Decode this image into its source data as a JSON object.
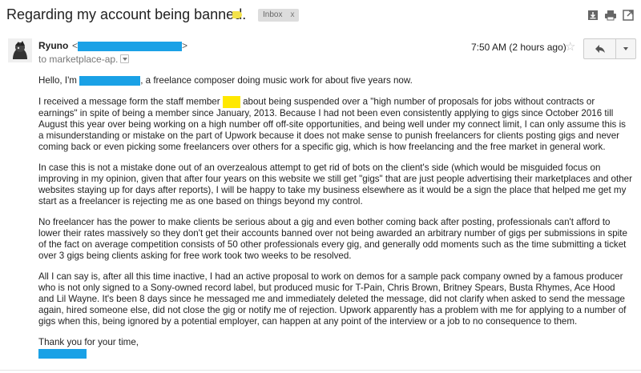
{
  "subject": "Regarding my account being banned.",
  "label": {
    "name": "Inbox",
    "remove": "x"
  },
  "sender": {
    "name": "Ryuno",
    "email_open": "<",
    "email_close": ">"
  },
  "recipient": "to marketplace-ap.",
  "time": "7:50 AM (2 hours ago)",
  "body": {
    "greeting_before": "Hello, I'm",
    "greeting_after": ", a freelance composer doing music work for about five years now.",
    "p1_before": "I received a message form the staff member",
    "p1_after": "about being suspended over a \"high number of proposals for jobs without contracts or earnings\" in spite of being a member since January, 2013. Because I had not been even consistently applying to gigs since October 2016 till August this year over being working on a high number off off-site opportunities, and being well under my connect limit, I can only assume this is a misunderstanding or mistake on the part of Upwork because it does not make sense to punish freelancers for clients posting gigs and never coming back or even picking some freelancers over others for a specific gig, which is how freelancing and the free market in general work.",
    "p2": "In case this is not a mistake done out of an overzealous attempt to get rid of bots on the client's side (which would be misguided focus on improving in my opinion, given that after four years on this website we still get \"gigs\" that are just people advertising their marketplaces and other websites staying up for days after reports), I will be happy to take my business elsewhere as it would be a sign the place that helped me get my start as a freelancer is rejecting me as one based on things beyond my control.",
    "p3": "No freelancer has the power to make clients be serious about a gig and even bother coming back after posting, professionals can't afford to lower their rates massively so they don't get their accounts banned over not being awarded an arbitrary number of gigs per submissions in spite of the fact on average competition consists of 50 other professionals every gig, and generally odd moments such as the time submitting a ticket over 3 gigs being clients asking for free work took two weeks to be resolved.",
    "p4": "All I can say is, after all this time inactive, I had an active proposal to work on demos for a sample pack company owned by a famous producer who is not only signed to a Sony-owned record label, but produced music for T-Pain, Chris Brown, Britney Spears, Busta Rhymes, Ace Hood and Lil Wayne. It's been 8 days since he messaged me and immediately deleted the message, did not clarify when asked to send the message again, hired someone else, did not close the gig or notify me of rejection. Upwork apparently has a problem with me for applying to a number of gigs when this, being ignored by a potential employer, can happen at any point of the interview or a job to no consequence to them.",
    "closing": "Thank you for your time,"
  },
  "icons": {
    "importance": "importance-marker-icon",
    "download": "download-icon",
    "print": "print-icon",
    "popout": "new-window-icon",
    "star": "star-icon",
    "reply": "reply-icon",
    "more": "chevron-down-icon"
  },
  "colors": {
    "redaction": "#1aa1e6",
    "highlight": "#ffe800",
    "importance": "#f3e24b"
  }
}
